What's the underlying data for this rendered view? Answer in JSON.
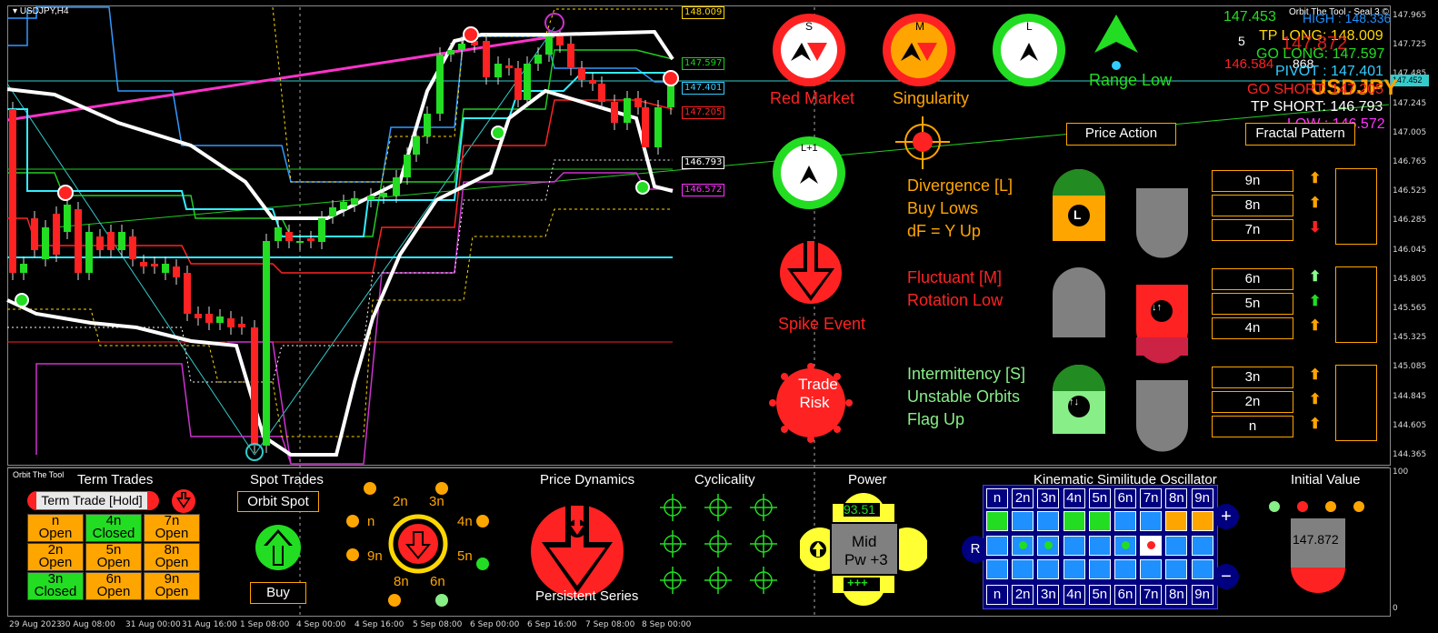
{
  "chart": {
    "symbol": "USDJPY,H4",
    "indicator_name": "Orbit The Tool - Seal 3 ©",
    "current_price_tag": "147.452",
    "price_axis": [
      "147.965",
      "147.725",
      "147.485",
      "147.245",
      "147.005",
      "146.765",
      "146.525",
      "146.285",
      "146.045",
      "145.805",
      "145.565",
      "145.325",
      "145.085",
      "144.845",
      "144.605",
      "144.365"
    ],
    "time_axis": [
      "29 Aug 2023",
      "30 Aug 08:00",
      "31 Aug 00:00",
      "31 Aug 16:00",
      "1 Sep 08:00",
      "4 Sep 00:00",
      "4 Sep 16:00",
      "5 Sep 08:00",
      "6 Sep 00:00",
      "6 Sep 16:00",
      "7 Sep 08:00",
      "8 Sep 00:00"
    ],
    "level_tags": [
      {
        "label": "148.009",
        "color": "#ffd700"
      },
      {
        "label": "147.597",
        "color": "#22cc22"
      },
      {
        "label": "147.401",
        "color": "#33ccff"
      },
      {
        "label": "147.205",
        "color": "#ff2222"
      },
      {
        "label": "146.793",
        "color": "#ffffff"
      },
      {
        "label": "146.572",
        "color": "#ff33ff"
      }
    ],
    "subwindow_axis_top": "100",
    "subwindow_axis_bottom": "0"
  },
  "info_panel": {
    "price_big": "147.453",
    "high_label": "HIGH : 148.336",
    "count": "5",
    "count2": "868",
    "tp_long": "TP LONG: 148.009",
    "price_mid": "147.872",
    "go_long": "GO LONG: 147.597",
    "low_big": "146.584",
    "pivot": "PIVOT : 147.401",
    "symbol_big": "USDJPY",
    "go_short": "GO SHORT: 147.205",
    "tp_short": "TP SHORT: 146.793",
    "low_label": "LOW : 146.572"
  },
  "signals": {
    "red_market": {
      "badge": "S",
      "label": "Red Market"
    },
    "singularity": {
      "badge": "M",
      "label": "Singularity"
    },
    "l_badge": {
      "badge": "L"
    },
    "range_low": {
      "label": "Range Low"
    },
    "l_plus_1": {
      "badge": "L+1"
    },
    "spike_event": {
      "label": "Spike Event"
    },
    "trade_risk": {
      "line1": "Trade",
      "line2": "Risk"
    },
    "price_action": "Price Action",
    "fractal_pattern": "Fractal Pattern"
  },
  "status_texts": {
    "divergence": [
      "Divergence [L]",
      "Buy Lows",
      "dF = Y Up"
    ],
    "fluctuant": [
      "Fluctuant [M]",
      "Rotation Low"
    ],
    "intermittency": [
      "Intermittency [S]",
      "Unstable Orbits",
      "Flag Up"
    ],
    "badge_l": "L"
  },
  "nrows": [
    {
      "label": "9n",
      "arrow": "up",
      "arrow_color": "#ffa500",
      "dot": "#22dd22"
    },
    {
      "label": "8n",
      "arrow": "up",
      "arrow_color": "#ffa500",
      "dot": "#22dd22"
    },
    {
      "label": "7n",
      "arrow": "down",
      "arrow_color": "#ff2222",
      "dot": "#ff2222"
    },
    {
      "label": "6n",
      "arrow": "up",
      "arrow_color": "#88ff88",
      "dot": "#ff2222"
    },
    {
      "label": "5n",
      "arrow": "up",
      "arrow_color": "#22dd22",
      "dot": "#22dd22"
    },
    {
      "label": "4n",
      "arrow": "up",
      "arrow_color": "#ffa500",
      "dot": "#22dd22"
    },
    {
      "label": "3n",
      "arrow": "up",
      "arrow_color": "#ffa500",
      "dot": "#22dd22"
    },
    {
      "label": "2n",
      "arrow": "up",
      "arrow_color": "#ffa500",
      "dot": "#22dd22"
    },
    {
      "label": "n",
      "arrow": "up",
      "arrow_color": "#ffa500",
      "dot": "#22dd22"
    }
  ],
  "bottom": {
    "brand": "Orbit The Tool",
    "term_trades": {
      "title": "Term Trades",
      "hold_button": "Term Trade [Hold]",
      "cells": [
        {
          "n": "n",
          "state": "Open",
          "color": "#ffa500"
        },
        {
          "n": "4n",
          "state": "Closed",
          "color": "#22dd22"
        },
        {
          "n": "7n",
          "state": "Open",
          "color": "#ffa500"
        },
        {
          "n": "2n",
          "state": "Open",
          "color": "#ffa500"
        },
        {
          "n": "5n",
          "state": "Open",
          "color": "#ffa500"
        },
        {
          "n": "8n",
          "state": "Open",
          "color": "#ffa500"
        },
        {
          "n": "3n",
          "state": "Closed",
          "color": "#22dd22"
        },
        {
          "n": "6n",
          "state": "Open",
          "color": "#ffa500"
        },
        {
          "n": "9n",
          "state": "Open",
          "color": "#ffa500"
        }
      ]
    },
    "spot_trades": {
      "title": "Spot Trades",
      "orbit_spot": "Orbit Spot",
      "buy": "Buy"
    },
    "dial": {
      "labels": [
        "2n",
        "3n",
        "4n",
        "5n",
        "6n",
        "8n",
        "9n",
        "n"
      ]
    },
    "price_dynamics": {
      "title": "Price Dynamics",
      "caption": "Persistent Series"
    },
    "cyclicality": {
      "title": "Cyclicality"
    },
    "power": {
      "title": "Power",
      "value": "93.51",
      "line1": "Mid",
      "line2": "Pw +3",
      "bar": "+++"
    },
    "kso": {
      "title": "Kinematic Similitude Oscillator",
      "headers": [
        "n",
        "2n",
        "3n",
        "4n",
        "5n",
        "6n",
        "7n",
        "8n",
        "9n"
      ],
      "row1": [
        "#22dd22",
        "#1e90ff",
        "#1e90ff",
        "#22dd22",
        "#22dd22",
        "#1e90ff",
        "#1e90ff",
        "#ffa500",
        "#ffa500"
      ],
      "row2_dots": [
        "none",
        "#22dd22",
        "#22dd22",
        "none",
        "none",
        "#22dd22",
        "#ff2222",
        "none",
        "none"
      ],
      "row2_highlight": [
        false,
        false,
        false,
        false,
        false,
        false,
        true,
        false,
        false
      ],
      "r_label": "R",
      "plus": "+",
      "minus": "−"
    },
    "initial_value": {
      "title": "Initial Value",
      "value": "147.872",
      "dots": [
        "#88ee88",
        "#ff2222",
        "#ffa500",
        "#ffa500"
      ]
    }
  }
}
